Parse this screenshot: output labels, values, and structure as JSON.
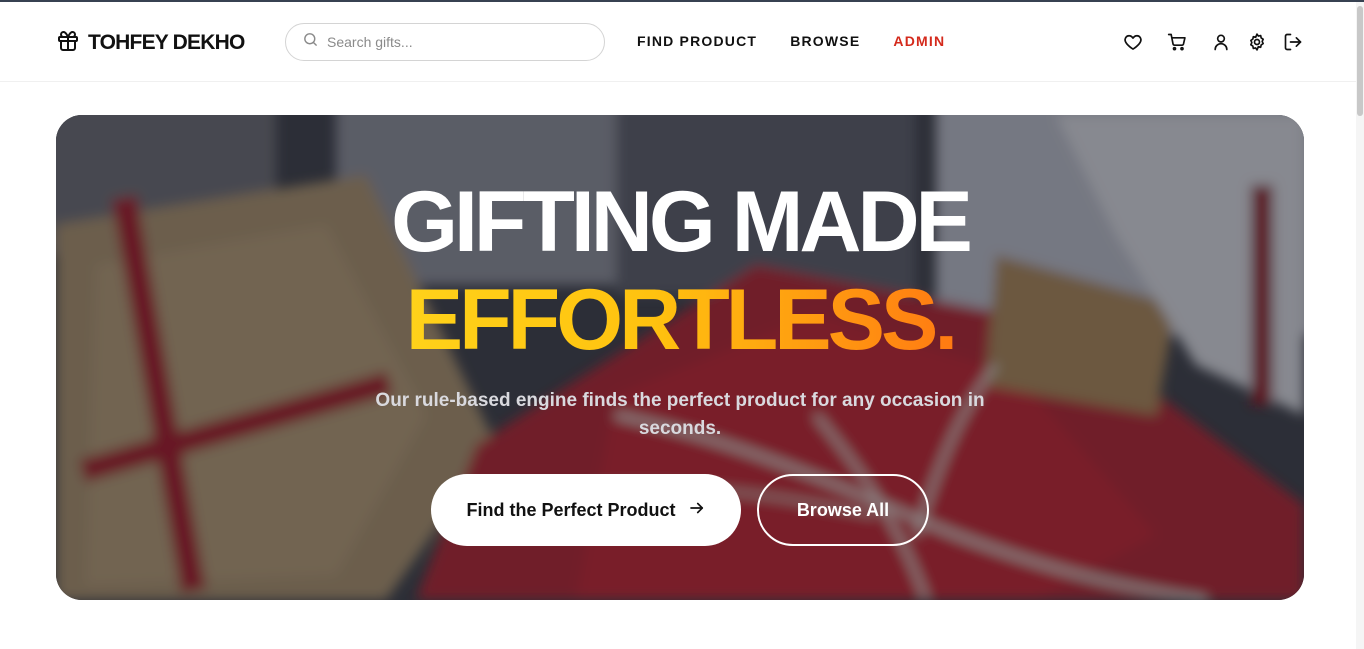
{
  "header": {
    "logo_text": "TOHFEY DEKHO",
    "logo_icon": "gift-icon",
    "search": {
      "placeholder": "Search gifts...",
      "value": ""
    },
    "nav": [
      {
        "label": "FIND PRODUCT"
      },
      {
        "label": "BROWSE"
      },
      {
        "label": "ADMIN",
        "color": "#d42a1c"
      }
    ],
    "icons": [
      "heart-icon",
      "cart-icon",
      "user-icon",
      "gear-icon",
      "logout-icon"
    ]
  },
  "hero": {
    "title_line1": "GIFTING MADE",
    "title_line2": "EFFORTLESS.",
    "subtitle": "Our rule-based engine finds the perfect product for any occasion in seconds.",
    "primary_button": "Find the Perfect Product",
    "secondary_button": "Browse All",
    "gradient_colors": [
      "#ffd21a",
      "#ff7a12"
    ]
  }
}
